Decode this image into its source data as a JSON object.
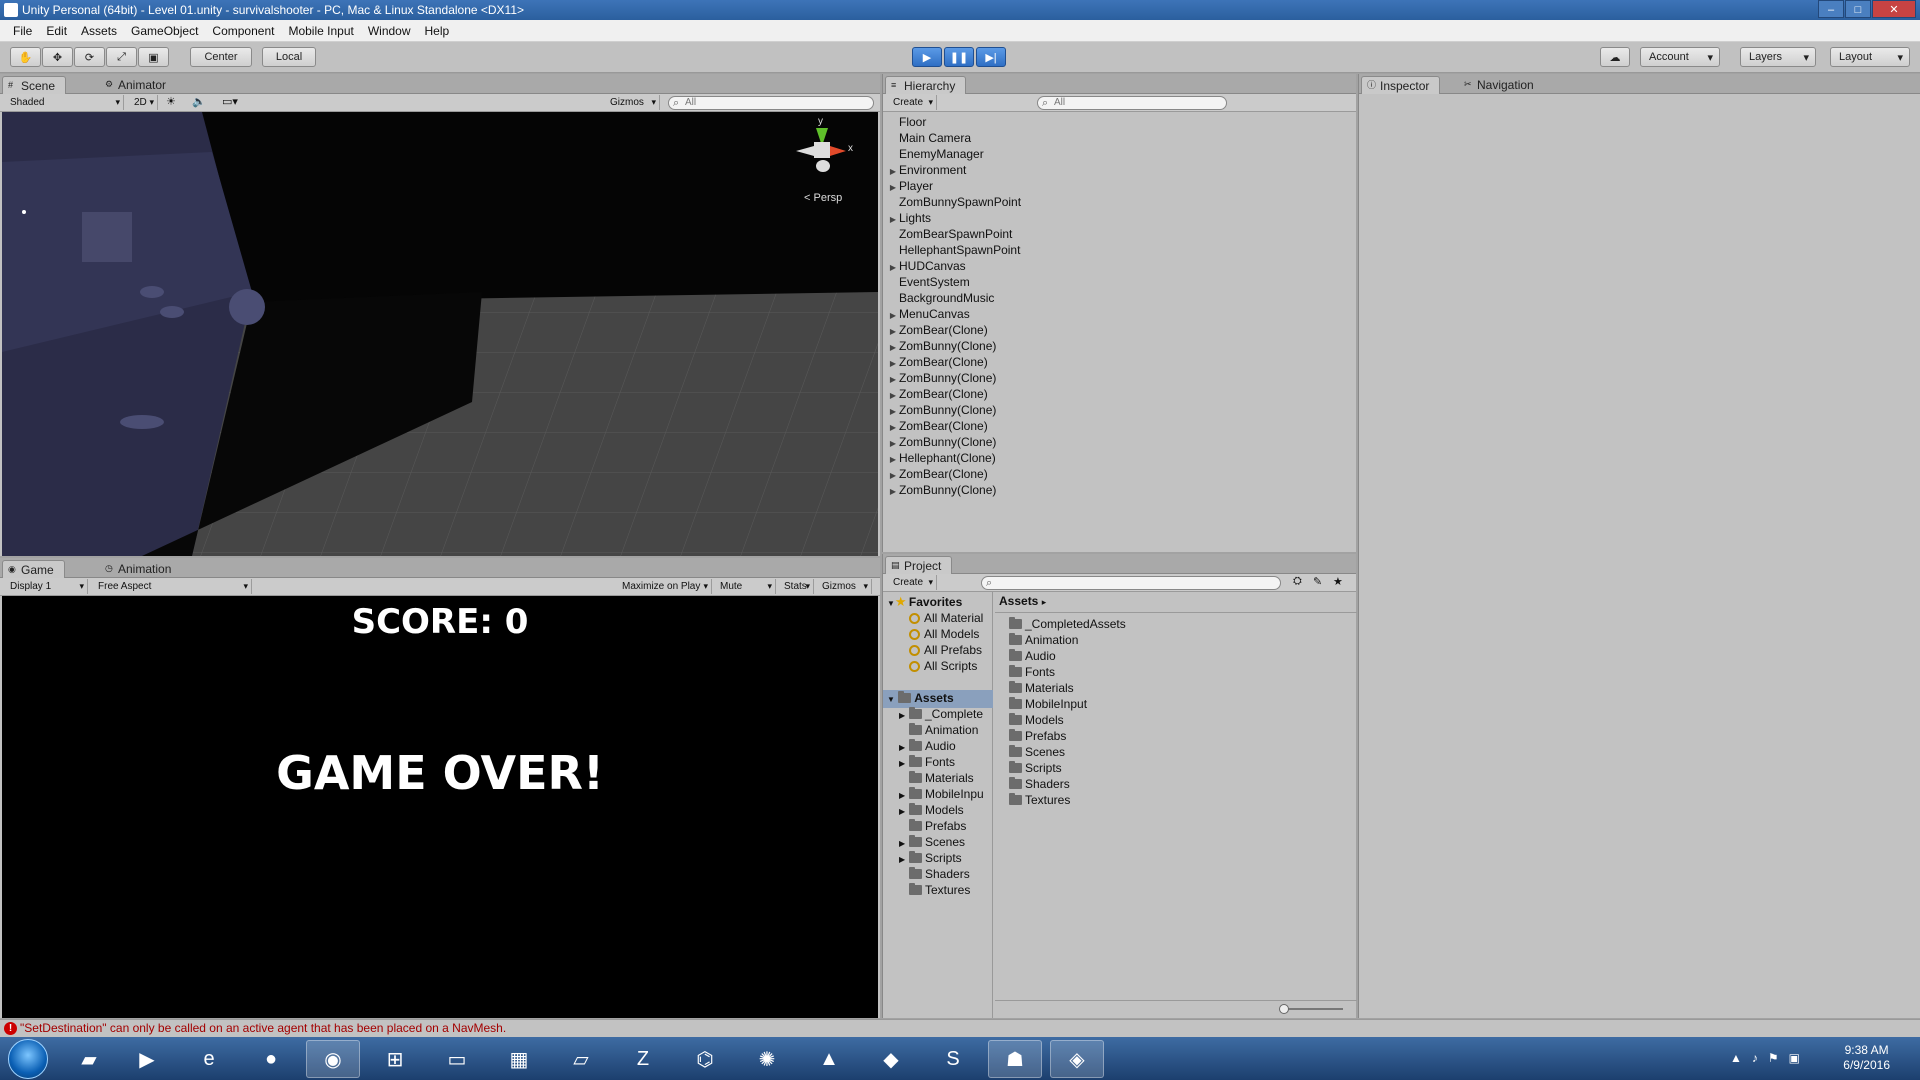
{
  "window": {
    "title": "Unity Personal (64bit) - Level 01.unity - survivalshooter - PC, Mac & Linux Standalone <DX11>"
  },
  "menu": [
    "File",
    "Edit",
    "Assets",
    "GameObject",
    "Component",
    "Mobile Input",
    "Window",
    "Help"
  ],
  "toolbar": {
    "tools": [
      "hand-icon",
      "move-icon",
      "rotate-icon",
      "scale-icon",
      "rect-icon"
    ],
    "pivot": "Center",
    "space": "Local",
    "account": "Account",
    "layers": "Layers",
    "layout": "Layout"
  },
  "scene": {
    "tabs": [
      "Scene",
      "Animator"
    ],
    "shading": "Shaded",
    "mode2d": "2D",
    "gizmos": "Gizmos",
    "search_placeholder": "All",
    "persp": "Persp",
    "axis_y": "y",
    "axis_x": "x"
  },
  "game": {
    "tabs": [
      "Game",
      "Animation"
    ],
    "display": "Display 1",
    "aspect": "Free Aspect",
    "maximize": "Maximize on Play",
    "mute": "Mute audio",
    "stats": "Stats",
    "gizmos": "Gizmos",
    "score": "SCORE: 0",
    "gameover": "GAME OVER!"
  },
  "hierarchy": {
    "title": "Hierarchy",
    "create": "Create",
    "search_placeholder": "All",
    "items": [
      {
        "label": "Floor",
        "arrow": false
      },
      {
        "label": "Main Camera",
        "arrow": false
      },
      {
        "label": "EnemyManager",
        "arrow": false
      },
      {
        "label": "Environment",
        "arrow": true
      },
      {
        "label": "Player",
        "arrow": true
      },
      {
        "label": "ZomBunnySpawnPoint",
        "arrow": false
      },
      {
        "label": "Lights",
        "arrow": true
      },
      {
        "label": "ZomBearSpawnPoint",
        "arrow": false
      },
      {
        "label": "HellephantSpawnPoint",
        "arrow": false
      },
      {
        "label": "HUDCanvas",
        "arrow": true
      },
      {
        "label": "EventSystem",
        "arrow": false
      },
      {
        "label": "BackgroundMusic",
        "arrow": false
      },
      {
        "label": "MenuCanvas",
        "arrow": true
      },
      {
        "label": "ZomBear(Clone)",
        "arrow": true
      },
      {
        "label": "ZomBunny(Clone)",
        "arrow": true
      },
      {
        "label": "ZomBear(Clone)",
        "arrow": true
      },
      {
        "label": "ZomBunny(Clone)",
        "arrow": true
      },
      {
        "label": "ZomBear(Clone)",
        "arrow": true
      },
      {
        "label": "ZomBunny(Clone)",
        "arrow": true
      },
      {
        "label": "ZomBear(Clone)",
        "arrow": true
      },
      {
        "label": "ZomBunny(Clone)",
        "arrow": true
      },
      {
        "label": "Hellephant(Clone)",
        "arrow": true
      },
      {
        "label": "ZomBear(Clone)",
        "arrow": true
      },
      {
        "label": "ZomBunny(Clone)",
        "arrow": true
      }
    ]
  },
  "inspector": {
    "tabs": [
      "Inspector",
      "Navigation"
    ]
  },
  "project": {
    "title": "Project",
    "create": "Create",
    "favorites_label": "Favorites",
    "favorites": [
      "All Material",
      "All Models",
      "All Prefabs",
      "All Scripts"
    ],
    "assets_label": "Assets",
    "tree": [
      {
        "label": "_Complete",
        "arrow": true
      },
      {
        "label": "Animation",
        "arrow": false
      },
      {
        "label": "Audio",
        "arrow": true
      },
      {
        "label": "Fonts",
        "arrow": true
      },
      {
        "label": "Materials",
        "arrow": false
      },
      {
        "label": "MobileInpu",
        "arrow": true
      },
      {
        "label": "Models",
        "arrow": true
      },
      {
        "label": "Prefabs",
        "arrow": false
      },
      {
        "label": "Scenes",
        "arrow": true
      },
      {
        "label": "Scripts",
        "arrow": true
      },
      {
        "label": "Shaders",
        "arrow": false
      },
      {
        "label": "Textures",
        "arrow": false
      }
    ],
    "breadcrumb": "Assets",
    "grid": [
      "_CompletedAssets",
      "Animation",
      "Audio",
      "Fonts",
      "Materials",
      "MobileInput",
      "Models",
      "Prefabs",
      "Scenes",
      "Scripts",
      "Shaders",
      "Textures"
    ]
  },
  "status": {
    "message": "\"SetDestination\" can only be called on an active agent that has been placed on a NavMesh."
  },
  "taskbar": {
    "apps": [
      "explorer-icon",
      "media-player-icon",
      "internet-explorer-icon",
      "firefox-icon",
      "chrome-icon",
      "apps-grid-icon",
      "terminal-icon",
      "monitor-icon",
      "notepad-icon",
      "filezilla-icon",
      "python-icon",
      "blender-icon",
      "inkscape-icon",
      "git-icon",
      "sublime-icon",
      "android-icon",
      "unity-icon"
    ],
    "time": "9:38 AM",
    "date": "6/9/2016"
  }
}
